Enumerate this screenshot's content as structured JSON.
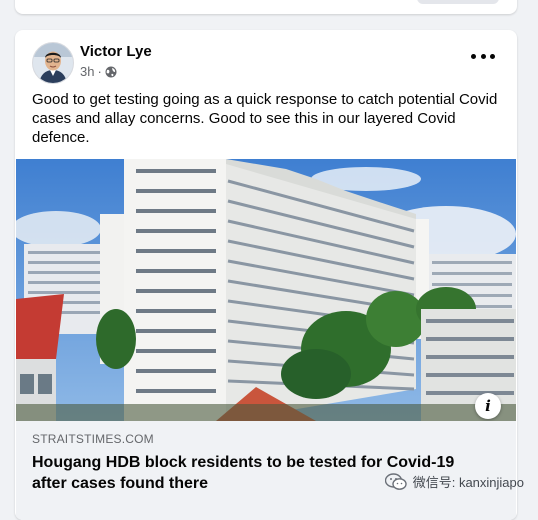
{
  "post": {
    "author": "Victor Lye",
    "time": "3h",
    "dot": "·",
    "text": "Good to get testing going as a quick response to catch potential Covid cases and allay concerns. Good to see this in our layered Covid defence."
  },
  "link": {
    "domain": "STRAITSTIMES.COM",
    "headline": "Hougang HDB block residents to be tested for Covid-19 after cases found there"
  },
  "watermark": {
    "label": "微信号: kanxinjiapo"
  },
  "icons": {
    "privacy": "globe-icon",
    "more": "more-options-icon",
    "info": "info-icon",
    "wechat": "wechat-icon"
  },
  "colors": {
    "text": "#050505",
    "secondary": "#65676b",
    "card_bg": "#ffffff",
    "page_bg": "#f0f2f5"
  }
}
